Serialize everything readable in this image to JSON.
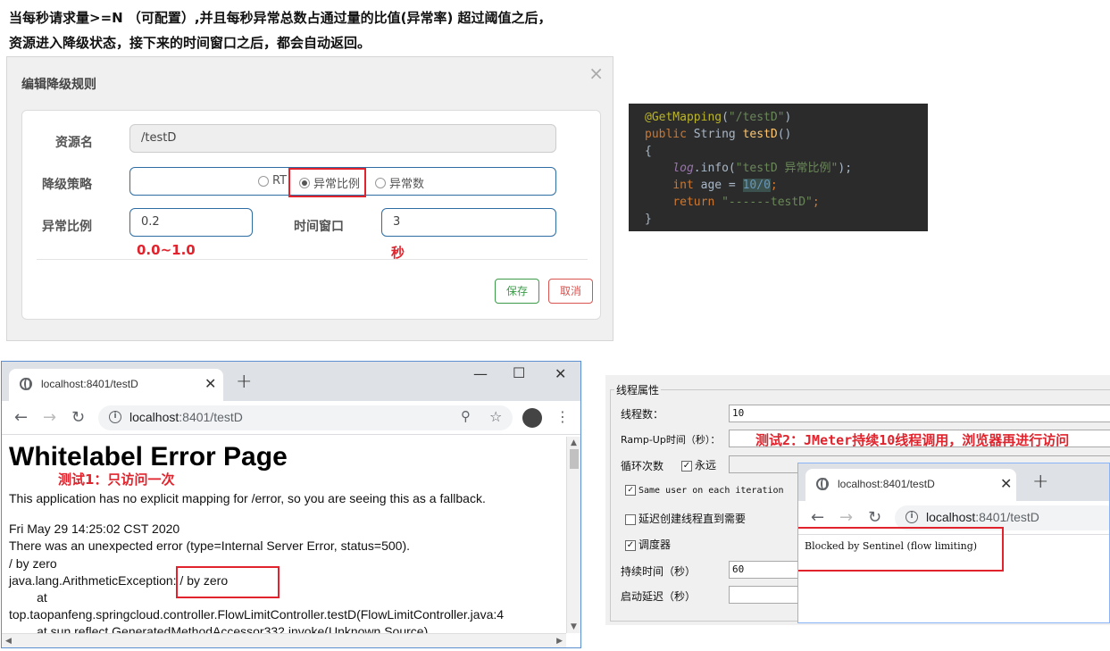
{
  "description": {
    "line1": "当每秒请求量>=N （可配置）,并且每秒异常总数占通过量的比值(异常率) 超过阈值之后，",
    "line2": "资源进入降级状态，接下来的时间窗口之后，都会自动返回。"
  },
  "dialog": {
    "title": "编辑降级规则",
    "close": "×",
    "resource_label": "资源名",
    "resource_value": "/testD",
    "strategy_label": "降级策略",
    "strategy_options": [
      "RT",
      "异常比例",
      "异常数"
    ],
    "strategy_selected": "异常比例",
    "ratio_label": "异常比例",
    "ratio_value": "0.2",
    "window_label": "时间窗口",
    "window_value": "3",
    "ratio_note": "0.0~1.0",
    "window_note": "秒",
    "save": "保存",
    "cancel": "取消"
  },
  "code": {
    "annotation": "@GetMapping",
    "path": "\"/testD\"",
    "kw_public": "public",
    "type_string": "String",
    "method": "testD",
    "log": "log",
    "info": ".info(",
    "log_msg": "\"testD 异常比例\"",
    "kw_int": "int",
    "var": "age",
    "expr": "10/0",
    "kw_return": "return",
    "ret_str": "\"------testD\""
  },
  "browser1": {
    "tab_title": "localhost:8401/testD",
    "url_host": "localhost",
    "url_path": ":8401/testD",
    "error_title": "Whitelabel Error Page",
    "test_note": "测试1：只访问一次",
    "lines": [
      "This application has no explicit mapping for /error, so you are seeing this as a fallback.",
      "Fri May 29 14:25:02 CST 2020",
      "There was an unexpected error (type=Internal Server Error, status=500).",
      "/ by zero",
      "java.lang.ArithmeticException: / by zero",
      "        at",
      "top.taopanfeng.springcloud.controller.FlowLimitController.testD(FlowLimitController.java:4",
      "        at sun.reflect.GeneratedMethodAccessor332.invoke(Unknown Source)"
    ]
  },
  "jmeter": {
    "group_title": "线程属性",
    "threads_label": "线程数：",
    "threads_value": "10",
    "rampup_label": "Ramp-Up时间（秒）：",
    "loop_label": "循环次数",
    "forever_label": "永远",
    "same_user_label": "Same user on each iteration",
    "delay_label": "延迟创建线程直到需要",
    "scheduler_label": "调度器",
    "duration_label": "持续时间（秒）",
    "duration_value": "60",
    "startup_label": "启动延迟（秒）",
    "test_note": "测试2：JMeter持续10线程调用，浏览器再进行访问"
  },
  "browser2": {
    "tab_title": "localhost:8401/testD",
    "url_host": "localhost",
    "url_path": ":8401/testD",
    "body_text": "Blocked by Sentinel (flow limiting)"
  },
  "colors": {
    "highlight_red": "#e0232c",
    "primary_border": "#2e6da4",
    "save_green": "#3c9a49",
    "cancel_red": "#d9534f"
  }
}
